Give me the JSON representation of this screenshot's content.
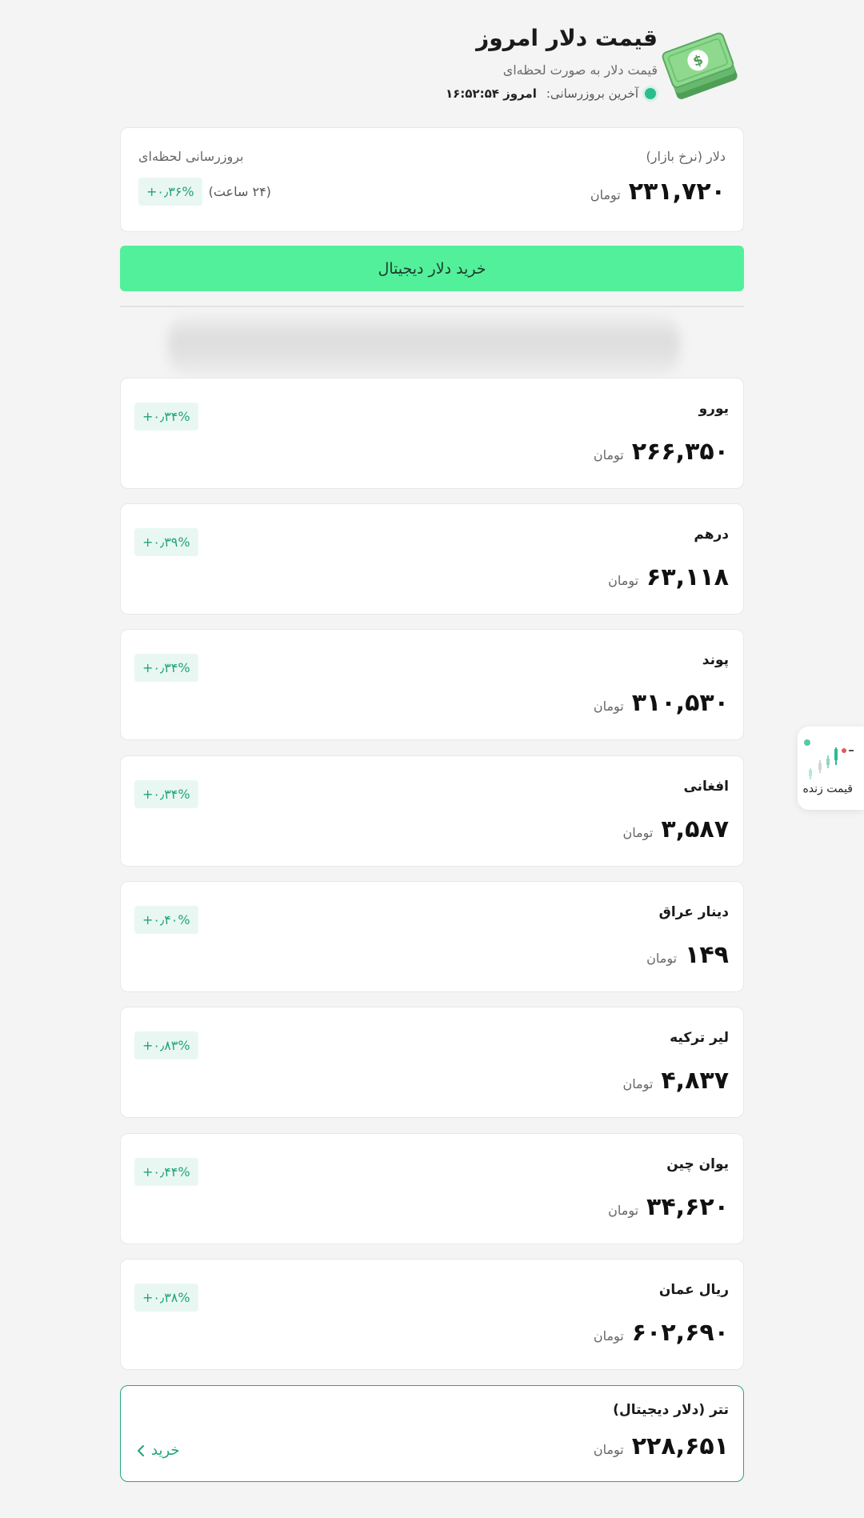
{
  "header": {
    "title": "قیمت دلار امروز",
    "subtitle": "قیمت دلار به صورت لحظه‌ای",
    "update_label": "آخرین بروزرسانی:",
    "update_value": "امروز ۱۶:۵۲:۵۴"
  },
  "main_card": {
    "name": "دلار (نرخ بازار)",
    "price": "۲۳۱,۷۲۰",
    "unit": "تومان",
    "update_note": "بروزرسانی لحظه‌ای",
    "period": "(۲۴ ساعت)",
    "change": "+۰٫۳۶%"
  },
  "buy_button_label": "خرید دلار دیجیتال",
  "currencies": [
    {
      "name": "یورو",
      "price": "۲۶۶,۳۵۰",
      "unit": "تومان",
      "change": "+۰٫۳۴%"
    },
    {
      "name": "درهم",
      "price": "۶۳,۱۱۸",
      "unit": "تومان",
      "change": "+۰٫۳۹%"
    },
    {
      "name": "پوند",
      "price": "۳۱۰,۵۳۰",
      "unit": "تومان",
      "change": "+۰٫۳۴%"
    },
    {
      "name": "افغانی",
      "price": "۳,۵۸۷",
      "unit": "تومان",
      "change": "+۰٫۳۴%"
    },
    {
      "name": "دینار عراق",
      "price": "۱۴۹",
      "unit": "تومان",
      "change": "+۰٫۴۰%"
    },
    {
      "name": "لیر ترکیه",
      "price": "۴,۸۳۷",
      "unit": "تومان",
      "change": "+۰٫۸۳%"
    },
    {
      "name": "یوان چین",
      "price": "۳۴,۶۲۰",
      "unit": "تومان",
      "change": "+۰٫۴۴%"
    },
    {
      "name": "ریال عمان",
      "price": "۶۰۲,۶۹۰",
      "unit": "تومان",
      "change": "+۰٫۳۸%"
    }
  ],
  "tether": {
    "name": "تتر (دلار دیجیتال)",
    "price": "۲۲۸,۶۵۱",
    "unit": "تومان",
    "buy_label": "خرید"
  },
  "live_widget_label": "قیمت زنده",
  "colors": {
    "accent": "#52f09b",
    "positive": "#1fa37a",
    "badge_bg": "#e9f7f2",
    "border_teal": "#27a585"
  },
  "icons": [
    "money-stack-icon",
    "live-dot-icon",
    "chevron-left-icon",
    "candlestick-chart-icon"
  ]
}
